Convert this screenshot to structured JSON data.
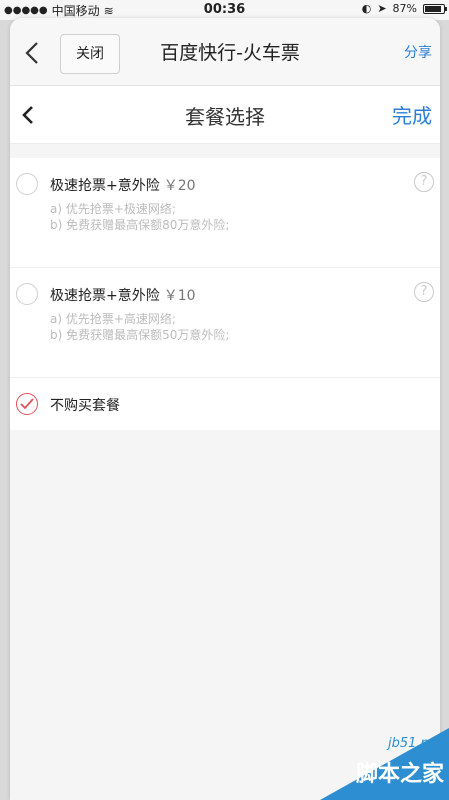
{
  "status_bar": {
    "carrier": "中国移动",
    "time": "00:36",
    "battery": "87%",
    "battery_level": 0.87
  },
  "window": {
    "close_label": "关闭",
    "title": "百度快行-火车票",
    "share_label": "分享"
  },
  "page": {
    "title": "套餐选择",
    "done_label": "完成"
  },
  "options": [
    {
      "title": "极速抢票+意外险",
      "price": "￥20",
      "desc_a": "a) 优先抢票+极速网络;",
      "desc_b": "b) 免费获赠最高保额80万意外险;",
      "selected": false
    },
    {
      "title": "极速抢票+意外险",
      "price": "￥10",
      "desc_a": "a) 优先抢票+高速网络;",
      "desc_b": "b) 免费获赠最高保额50万意外险;",
      "selected": false
    },
    {
      "title": "不购买套餐",
      "selected": true
    }
  ],
  "icons": {
    "back": "chevron-left-icon",
    "help": "question-circle-icon",
    "check": "checkmark-icon"
  },
  "colors": {
    "accent_blue": "#2a7fd4",
    "check_red": "#e3505a"
  },
  "watermark": {
    "site": "jb51.net",
    "name": "脚本之家"
  }
}
